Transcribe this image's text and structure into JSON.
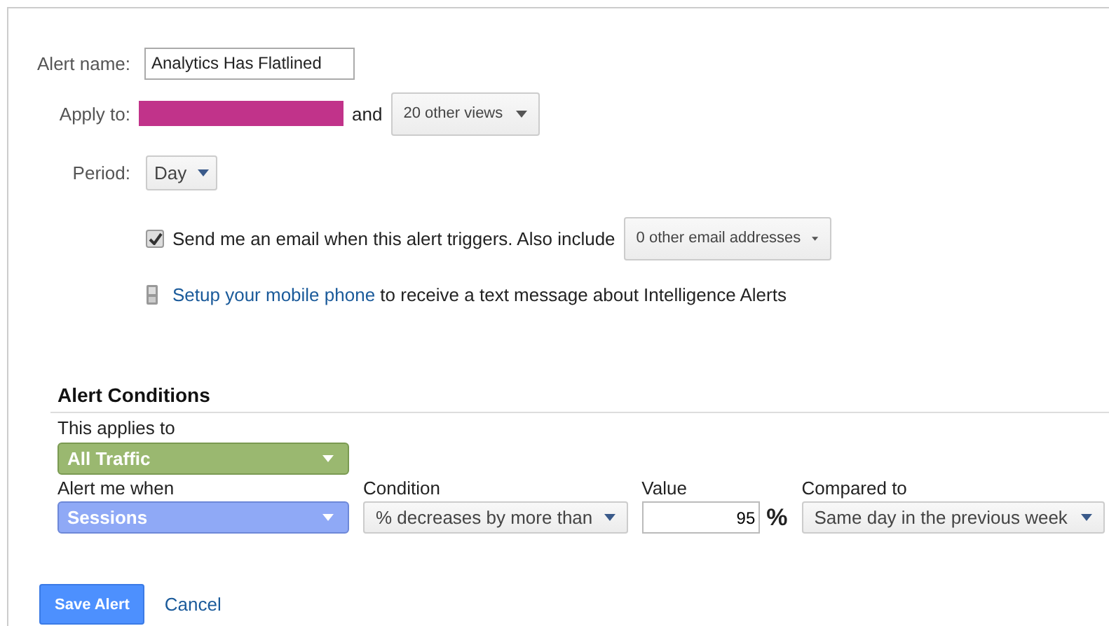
{
  "alert_name": {
    "label": "Alert name:",
    "value": "Analytics Has Flatlined"
  },
  "apply_to": {
    "label": "Apply to:",
    "joiner": "and",
    "views": "20 other views"
  },
  "period": {
    "label": "Period:",
    "value": "Day"
  },
  "email": {
    "checked": true,
    "label": "Send me an email when this alert triggers. Also include",
    "addresses": "0 other email addresses"
  },
  "mobile": {
    "link": "Setup your mobile phone",
    "text": "to receive a text message about Intelligence Alerts"
  },
  "conditions": {
    "heading": "Alert Conditions",
    "applies_label": "This applies to",
    "applies_value": "All Traffic",
    "fields": [
      {
        "kind": "metric",
        "label": "Alert me when",
        "value": "Sessions"
      },
      {
        "kind": "select",
        "label": "Condition",
        "value": "% decreases by more than"
      },
      {
        "kind": "number",
        "label": "Value",
        "value": "95",
        "unit": "%"
      },
      {
        "kind": "select",
        "label": "Compared to",
        "value": "Same day in the previous week"
      }
    ]
  },
  "buttons": {
    "save": "Save Alert",
    "cancel": "Cancel"
  }
}
